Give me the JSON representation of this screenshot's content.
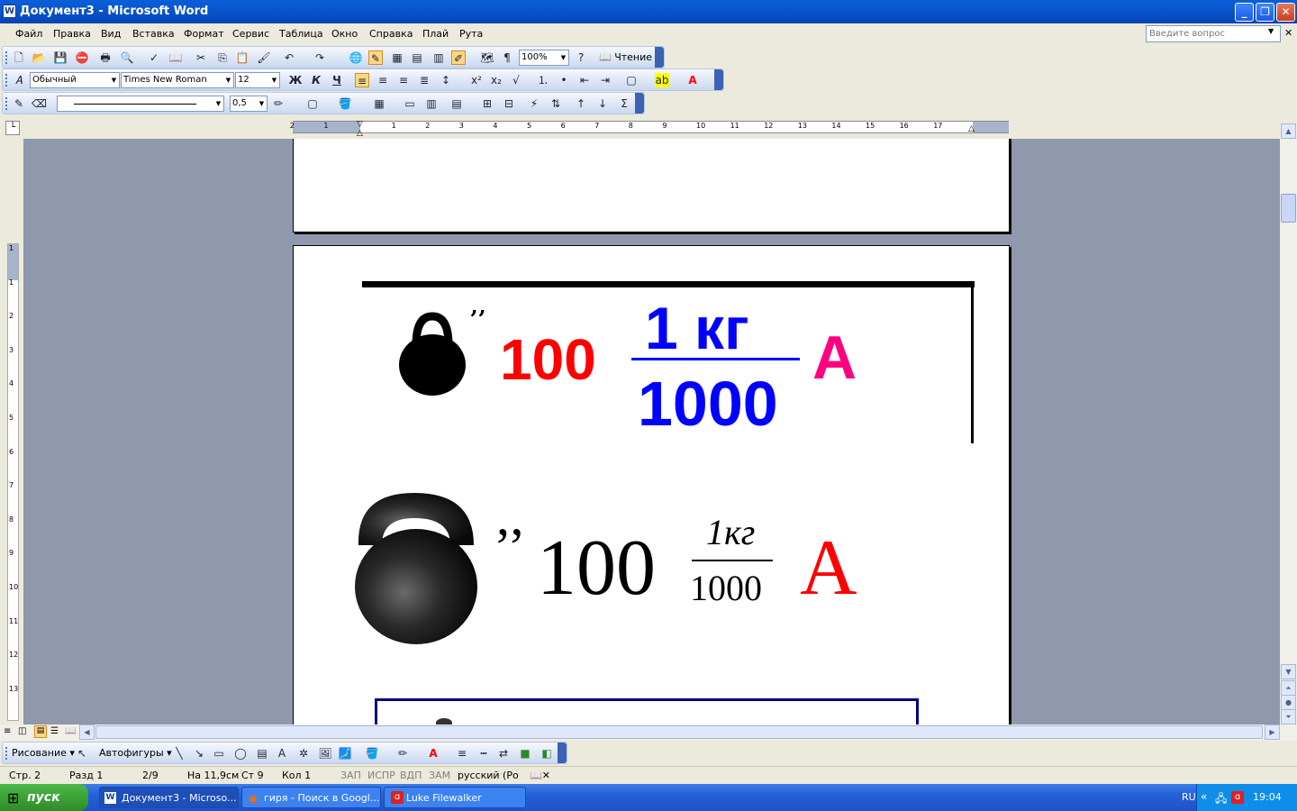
{
  "window": {
    "title": "Документ3 - Microsoft Word",
    "app_icon": "W"
  },
  "menu": {
    "items": [
      "Файл",
      "Правка",
      "Вид",
      "Вставка",
      "Формат",
      "Сервис",
      "Таблица",
      "Окно",
      "Справка",
      "Плай",
      "Рута"
    ],
    "ask_placeholder": "Введите вопрос"
  },
  "toolbar": {
    "zoom": "100%",
    "read_label": "Чтение",
    "style": "Обычный",
    "font": "Times New Roman",
    "size": "12",
    "bold": "Ж",
    "italic": "К",
    "underline": "Ч",
    "line_weight": "0,5",
    "pilcrow": "¶",
    "sigma": "Σ"
  },
  "ruler": {
    "labels": [
      "2",
      "1",
      "1",
      "2",
      "3",
      "4",
      "5",
      "6",
      "7",
      "8",
      "9",
      "10",
      "11",
      "12",
      "13",
      "14",
      "15",
      "16",
      "17"
    ],
    "v_labels": [
      "1",
      "1",
      "2",
      "3",
      "4",
      "5",
      "6",
      "7",
      "8",
      "9",
      "10",
      "11",
      "12",
      "13"
    ]
  },
  "document": {
    "quote_small": "‚‚",
    "number1": "100",
    "frac1_num": "1 кг",
    "frac1_den": "1000",
    "letter1": "А",
    "quote_big": "’’",
    "number2": "100",
    "frac2_num": "1кг",
    "frac2_den": "1000",
    "letter2": "А",
    "colors": {
      "red": "#ff0000",
      "blue": "#0000ff",
      "magenta": "#ff007f"
    }
  },
  "drawing_bar": {
    "drawing": "Рисование",
    "autoshapes": "Автофигуры"
  },
  "status": {
    "page": "Стр. 2",
    "section": "Разд 1",
    "pages": "2/9",
    "at": "На 11,9см",
    "line": "Ст 9",
    "col": "Кол 1",
    "rec": "ЗАП",
    "trk": "ИСПР",
    "ext": "ВДП",
    "ovr": "ЗАМ",
    "lang": "русский (Ро"
  },
  "taskbar": {
    "start": "пуск",
    "tasks": [
      "Документ3 - Microso...",
      "гиря - Поиск в Googl...",
      "Luke Filewalker"
    ],
    "lang": "RU",
    "time": "19:04"
  }
}
